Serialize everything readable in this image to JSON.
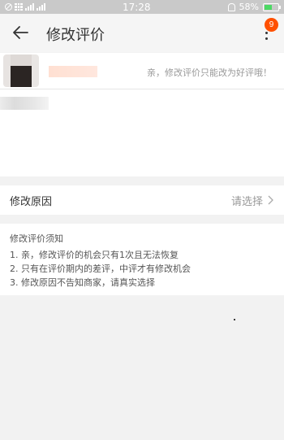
{
  "status_bar": {
    "time": "17:28",
    "battery": "58%"
  },
  "header": {
    "title": "修改评价",
    "badge_count": "9"
  },
  "product": {
    "hint": "亲，修改评价只能改为好评哦！"
  },
  "reason": {
    "label": "修改原因",
    "value": "请选择"
  },
  "notice": {
    "title": "修改评价须知",
    "items": [
      "1. 亲，修改评价的机会只有1次且无法恢复",
      "2. 只有在评价期内的差评，中评才有修改机会",
      "3. 修改原因不告知商家，请真实选择"
    ]
  },
  "colors": {
    "badge": "#ff5000",
    "status_bar": "#c9c9c9",
    "battery": "#4cd964"
  }
}
